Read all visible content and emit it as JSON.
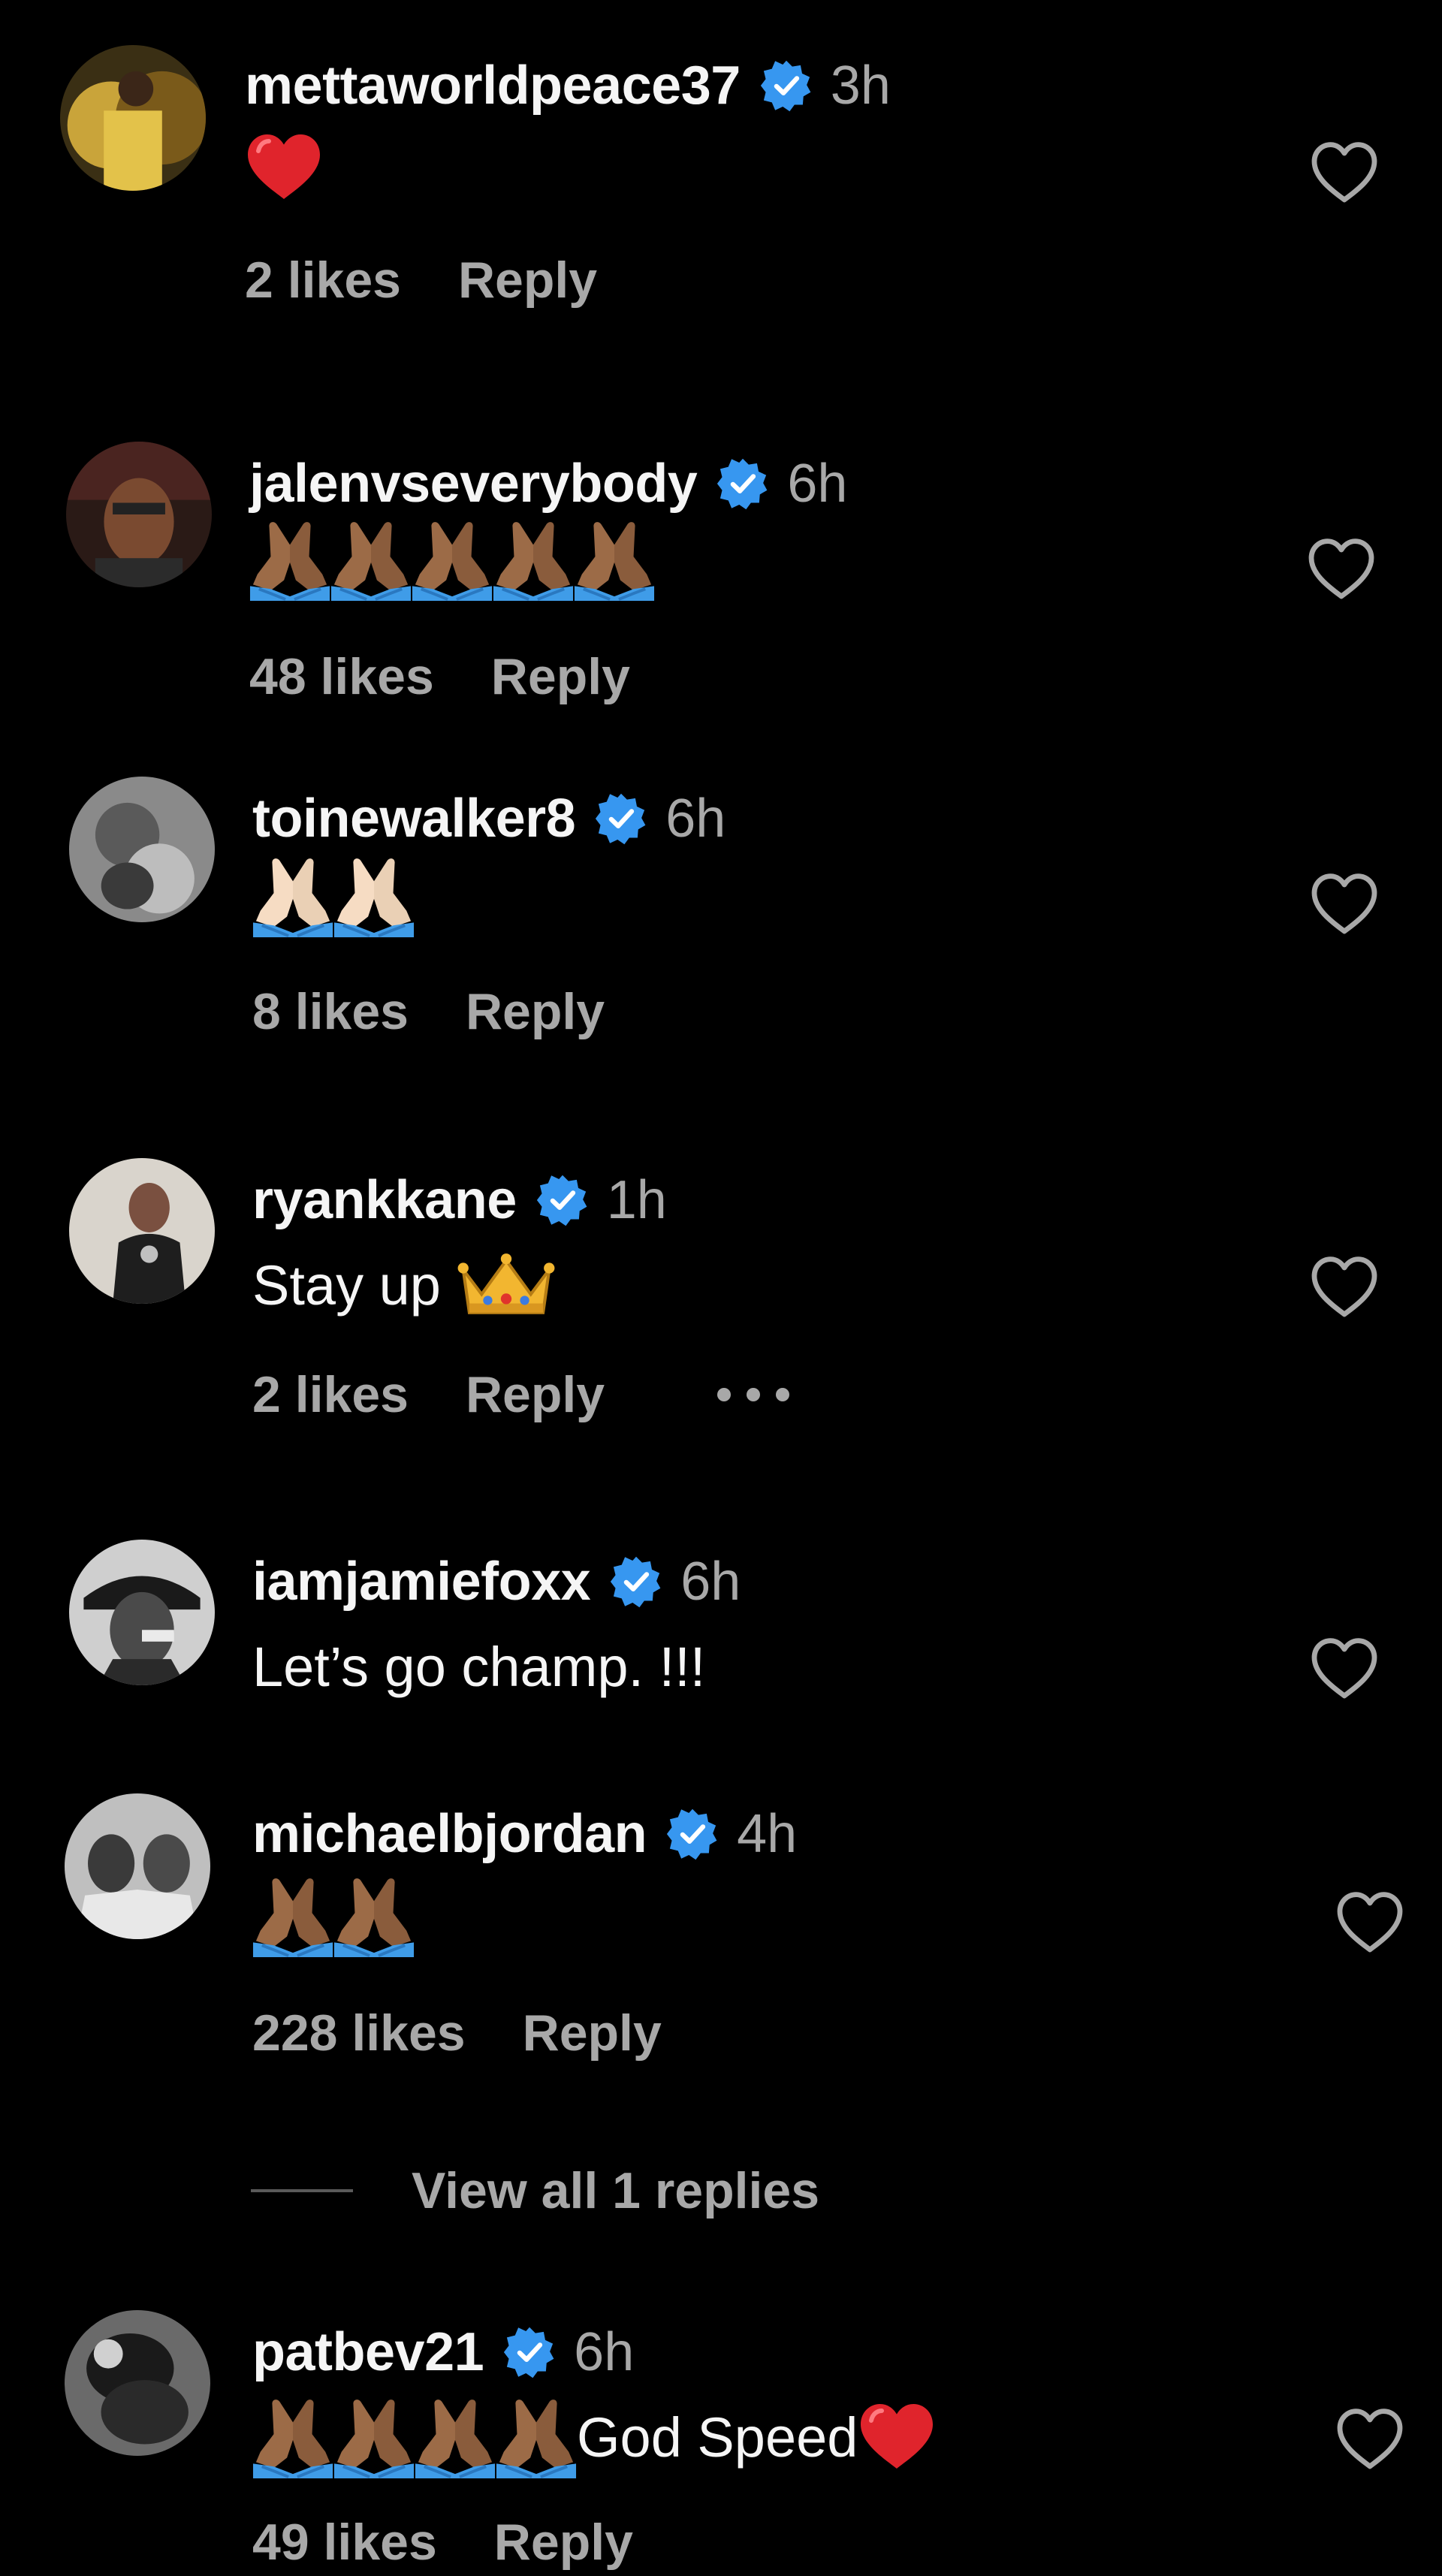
{
  "colors": {
    "background": "#000000",
    "text": "#f5f5f5",
    "secondary": "#a8a8a8",
    "verified": "#3797f0",
    "heart_red": "#e0242c"
  },
  "icons": {
    "verified": "verified-badge-icon",
    "like": "heart-outline-icon",
    "more": "more-horizontal-icon"
  },
  "comments": [
    {
      "username": "mettaworldpeace37",
      "time": "3h",
      "text": "",
      "emojis": [
        "red-heart"
      ],
      "likes": "2 likes",
      "reply": "Reply"
    },
    {
      "username": "jalenvseverybody",
      "time": "6h",
      "text": "",
      "emojis": [
        "folded-hands-medium-dark",
        "folded-hands-medium-dark",
        "folded-hands-medium-dark",
        "folded-hands-medium-dark",
        "folded-hands-medium-dark"
      ],
      "likes": "48 likes",
      "reply": "Reply"
    },
    {
      "username": "toinewalker8",
      "time": "6h",
      "text": "",
      "emojis": [
        "folded-hands-light",
        "folded-hands-light"
      ],
      "likes": "8 likes",
      "reply": "Reply"
    },
    {
      "username": "ryankkane",
      "time": "1h",
      "text": "Stay up",
      "emojis": [
        "crown"
      ],
      "likes": "2 likes",
      "reply": "Reply"
    },
    {
      "username": "iamjamiefoxx",
      "time": "6h",
      "text": "Let’s go champ. !!!",
      "emojis": []
    },
    {
      "username": "michaelbjordan",
      "time": "4h",
      "text": "",
      "emojis": [
        "folded-hands-medium-dark",
        "folded-hands-medium-dark"
      ],
      "likes": "228 likes",
      "reply": "Reply",
      "view_replies": "View all 1 replies"
    },
    {
      "username": "patbev21",
      "time": "6h",
      "text": "God Speed",
      "emojis": [
        "folded-hands-medium-dark",
        "folded-hands-medium-dark",
        "folded-hands-medium-dark",
        "folded-hands-medium-dark",
        "red-heart"
      ],
      "likes": "49 likes",
      "reply": "Reply"
    }
  ]
}
